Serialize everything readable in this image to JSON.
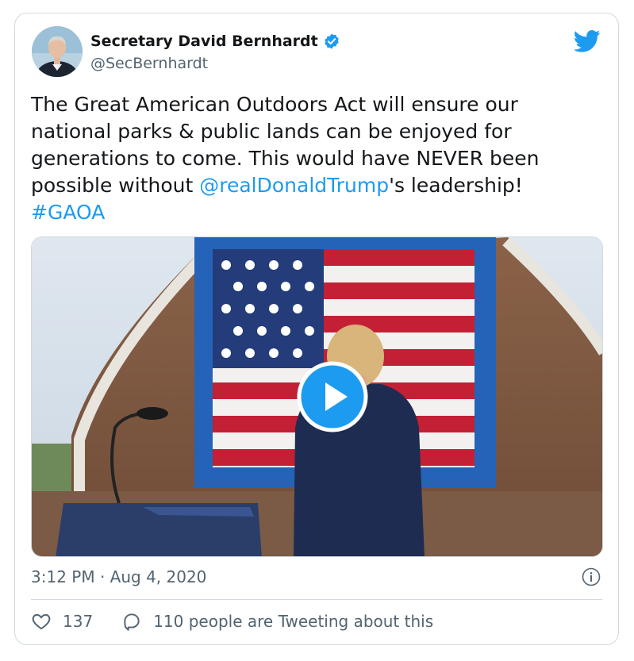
{
  "tweet": {
    "author_name": "Secretary David Bernhardt",
    "author_handle": "@SecBernhardt",
    "text_before": "The Great American Outdoors Act will ensure our national parks & public lands can be enjoyed for generations to come. This would have NEVER been possible without ",
    "mention": "@realDonaldTrump",
    "text_after": "'s leadership!",
    "hashtag": "#GAOA",
    "timestamp": "3:12 PM · Aug 4, 2020",
    "likes": "137",
    "conversation_label": "110 people are Tweeting about this"
  },
  "icons": {
    "verified": "verified-badge-icon",
    "brand": "twitter-bird-icon",
    "play": "play-icon",
    "info": "info-icon",
    "like": "heart-icon",
    "reply": "speech-bubble-icon"
  },
  "colors": {
    "accent": "#1d9bf0",
    "text": "#14171a",
    "muted": "#536471",
    "border": "#cfd9de"
  }
}
